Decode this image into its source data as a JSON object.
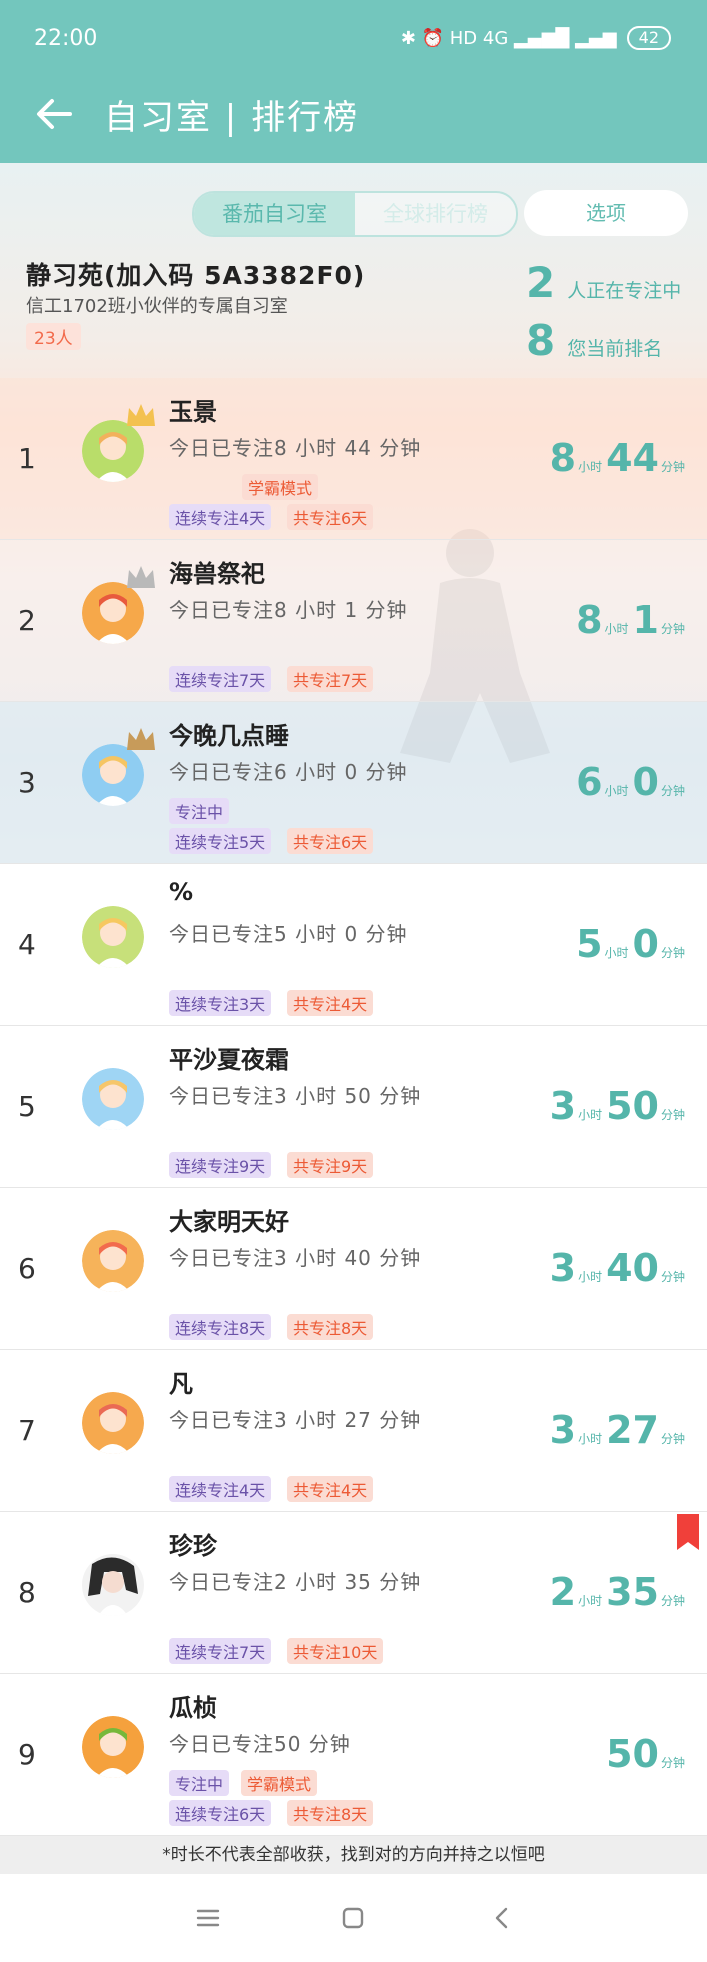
{
  "status": {
    "time": "22:00",
    "icons": "✱ ⏰ HD 4G ▂▄▆█ ▂▄▆",
    "battery": "42"
  },
  "header": {
    "title": "自习室 | 排行榜"
  },
  "segments": [
    {
      "label": "番茄自习室",
      "active": true
    },
    {
      "label": "全球排行榜",
      "active": false
    }
  ],
  "options_label": "选项",
  "room": {
    "name": "静习苑(加入码 5A3382F0)",
    "desc": "信工1702班小伙伴的专属自习室",
    "members": "23人",
    "focusing_count": "2",
    "focusing_label": "人正在专注中",
    "my_rank": "8",
    "my_rank_label": "您当前排名"
  },
  "units": {
    "hour": "小时",
    "minute": "分钟"
  },
  "rows": [
    {
      "rank": "1",
      "name": "玉景",
      "today": "今日已专注8 小时 44 分钟",
      "hours": "8",
      "minutes": "44",
      "tags1": [
        {
          "t": "学霸模式",
          "c": "red",
          "off": 60
        }
      ],
      "streak": "连续专注4天",
      "total": "共专注6天",
      "crown": "gold",
      "avatar": "green",
      "hl": "hl1"
    },
    {
      "rank": "2",
      "name": "海兽祭祀",
      "today": "今日已专注8 小时 1 分钟",
      "hours": "8",
      "minutes": "1",
      "tags1": [],
      "streak": "连续专注7天",
      "total": "共专注7天",
      "crown": "silver",
      "avatar": "orange",
      "hl": "hl2"
    },
    {
      "rank": "3",
      "name": "今晚几点睡",
      "today": "今日已专注6 小时 0 分钟",
      "hours": "6",
      "minutes": "0",
      "tags1": [
        {
          "t": "专注中",
          "c": "purple",
          "off": 0
        }
      ],
      "streak": "连续专注5天",
      "total": "共专注6天",
      "crown": "bronze",
      "avatar": "blue",
      "hl": "hl3"
    },
    {
      "rank": "4",
      "name": "%",
      "today": "今日已专注5 小时 0 分钟",
      "hours": "5",
      "minutes": "0",
      "tags1": [],
      "streak": "连续专注3天",
      "total": "共专注4天",
      "avatar": "lime"
    },
    {
      "rank": "5",
      "name": "平沙夏夜霜",
      "today": "今日已专注3 小时 50 分钟",
      "hours": "3",
      "minutes": "50",
      "tags1": [],
      "streak": "连续专注9天",
      "total": "共专注9天",
      "avatar": "sky"
    },
    {
      "rank": "6",
      "name": "大家明天好",
      "today": "今日已专注3 小时 40 分钟",
      "hours": "3",
      "minutes": "40",
      "tags1": [],
      "streak": "连续专注8天",
      "total": "共专注8天",
      "avatar": "orange2"
    },
    {
      "rank": "7",
      "name": "凡",
      "today": "今日已专注3 小时 27 分钟",
      "hours": "3",
      "minutes": "27",
      "tags1": [],
      "streak": "连续专注4天",
      "total": "共专注4天",
      "avatar": "orange3"
    },
    {
      "rank": "8",
      "name": "珍珍",
      "today": "今日已专注2 小时 35 分钟",
      "hours": "2",
      "minutes": "35",
      "tags1": [],
      "streak": "连续专注7天",
      "total": "共专注10天",
      "avatar": "photo",
      "bookmark": true
    },
    {
      "rank": "9",
      "name": "瓜桢",
      "today": "今日已专注50 分钟",
      "hours": "",
      "minutes": "50",
      "tags1": [
        {
          "t": "专注中",
          "c": "purple",
          "off": 0
        },
        {
          "t": "学霸模式",
          "c": "red",
          "off": 72
        }
      ],
      "streak": "连续专注6天",
      "total": "共专注8天",
      "avatar": "girl"
    }
  ],
  "footer_note": "*时长不代表全部收获，找到对的方向并持之以恒吧",
  "colors": {
    "accent": "#73c6bd",
    "teal_text": "#55b5aa"
  }
}
